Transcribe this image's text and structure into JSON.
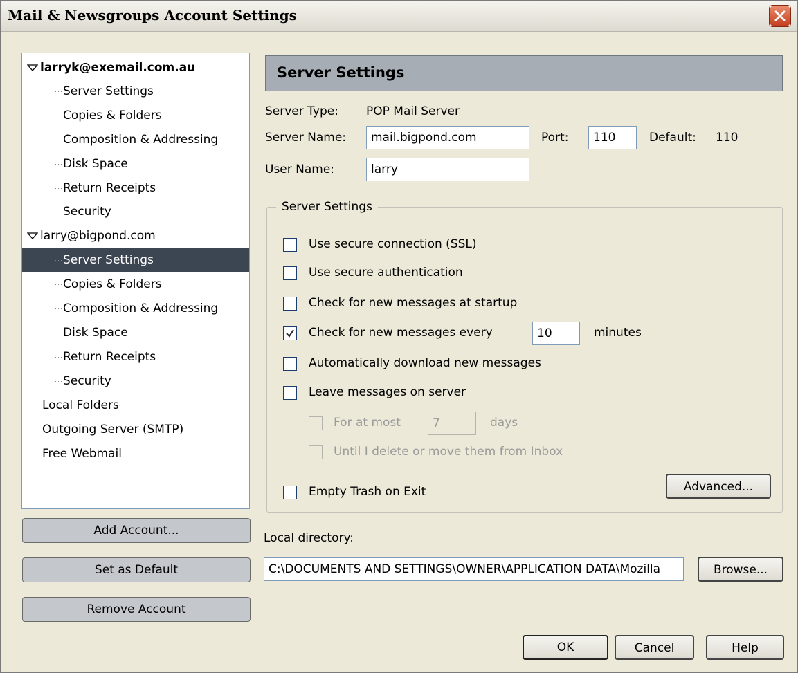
{
  "window": {
    "title": "Mail & Newsgroups Account Settings"
  },
  "tree": {
    "accounts": [
      {
        "label": "larryk@exemail.com.au",
        "children": [
          "Server Settings",
          "Copies & Folders",
          "Composition & Addressing",
          "Disk Space",
          "Return Receipts",
          "Security"
        ]
      },
      {
        "label": "larry@bigpond.com",
        "children": [
          "Server Settings",
          "Copies & Folders",
          "Composition & Addressing",
          "Disk Space",
          "Return Receipts",
          "Security"
        ],
        "selected_child": "Server Settings"
      }
    ],
    "top_items": [
      "Local Folders",
      "Outgoing Server (SMTP)",
      "Free Webmail"
    ]
  },
  "left_buttons": {
    "add_account": "Add Account...",
    "set_default": "Set as Default",
    "remove_account": "Remove Account"
  },
  "panel": {
    "header": "Server Settings",
    "server_type_label": "Server Type:",
    "server_type_value": "POP Mail Server",
    "server_name_label": "Server Name:",
    "server_name_value": "mail.bigpond.com",
    "port_label": "Port:",
    "port_value": "110",
    "default_label": "Default:",
    "default_value": "110",
    "user_name_label": "User Name:",
    "user_name_value": "larry"
  },
  "server_settings_group": {
    "title": "Server Settings",
    "ssl": {
      "label": "Use secure connection (SSL)",
      "checked": false
    },
    "secure_auth": {
      "label": "Use secure authentication",
      "checked": false
    },
    "check_startup": {
      "label": "Check for new messages at startup",
      "checked": false
    },
    "check_every": {
      "label": "Check for new messages every",
      "checked": true,
      "value": "10",
      "unit": "minutes"
    },
    "auto_download": {
      "label": "Automatically download new messages",
      "checked": false
    },
    "leave_on_server": {
      "label": "Leave messages on server",
      "checked": false
    },
    "for_at_most": {
      "label": "For at most",
      "checked": false,
      "value": "7",
      "unit": "days",
      "enabled": false
    },
    "until_delete": {
      "label": "Until I delete or move them from Inbox",
      "checked": false,
      "enabled": false
    },
    "empty_trash": {
      "label": "Empty Trash on Exit",
      "checked": false
    },
    "advanced_button": "Advanced..."
  },
  "local_directory": {
    "label": "Local directory:",
    "value": "C:\\DOCUMENTS AND SETTINGS\\OWNER\\APPLICATION DATA\\Mozilla",
    "browse_button": "Browse..."
  },
  "dialog_buttons": {
    "ok": "OK",
    "cancel": "Cancel",
    "help": "Help"
  }
}
